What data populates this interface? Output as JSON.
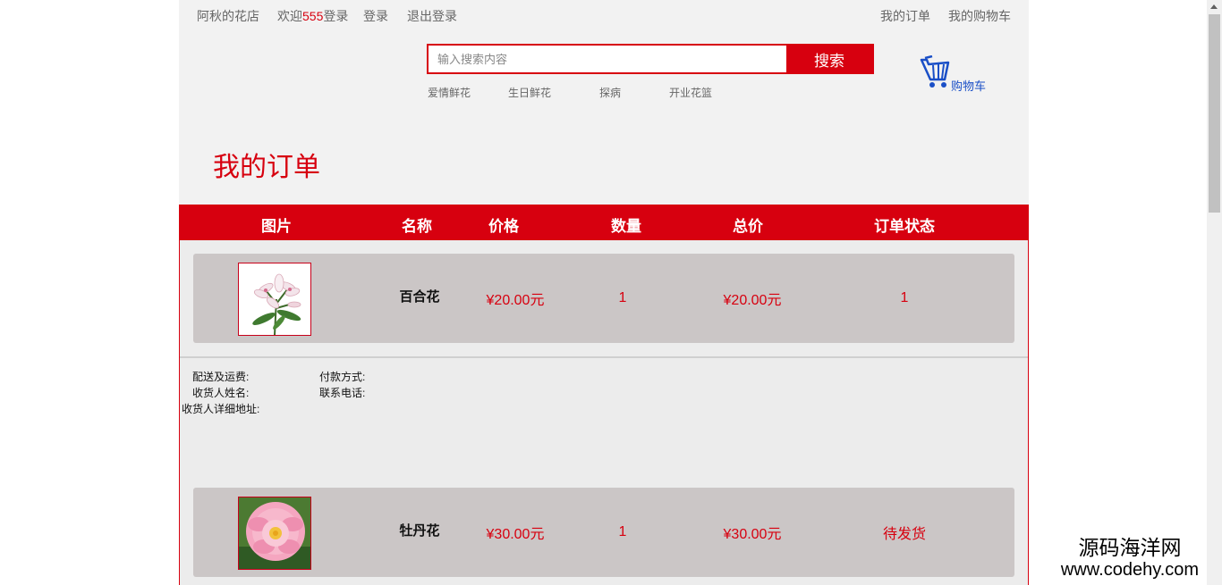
{
  "nav": {
    "shop_name": "阿秋的花店",
    "welcome_prefix": "欢迎",
    "username": "555",
    "welcome_suffix": "登录",
    "login": "登录",
    "logout": "退出登录",
    "my_orders": "我的订单",
    "my_cart": "我的购物车"
  },
  "search": {
    "placeholder": "输入搜索内容",
    "button": "搜索",
    "hot_links": [
      "爱情鲜花",
      "生日鲜花",
      "探病",
      "开业花篮"
    ]
  },
  "cart": {
    "label": "购物车",
    "icon": "shopping-cart-icon",
    "color": "#1a4fc7"
  },
  "page_title": "我的订单",
  "table": {
    "headers": [
      "图片",
      "名称",
      "价格",
      "数量",
      "总价",
      "订单状态"
    ]
  },
  "orders": [
    {
      "image": "lily-flower-image",
      "name": "百合花",
      "price": "¥20.00元",
      "quantity": "1",
      "total": "¥20.00元",
      "status": "1",
      "shipping_label": "配送及运费:",
      "payment_label": "付款方式:",
      "receiver_label": "收货人姓名:",
      "phone_label": "联系电话:",
      "address_label": "收货人详细地址:"
    },
    {
      "image": "peony-flower-image",
      "name": "牡丹花",
      "price": "¥30.00元",
      "quantity": "1",
      "total": "¥30.00元",
      "status": "待发货"
    }
  ],
  "watermark": {
    "line1": "源码海洋网",
    "line2": "www.codehy.com"
  },
  "colors": {
    "accent": "#d7000f",
    "row_bg": "#cbc6c6",
    "page_bg": "#f2f2f2"
  }
}
